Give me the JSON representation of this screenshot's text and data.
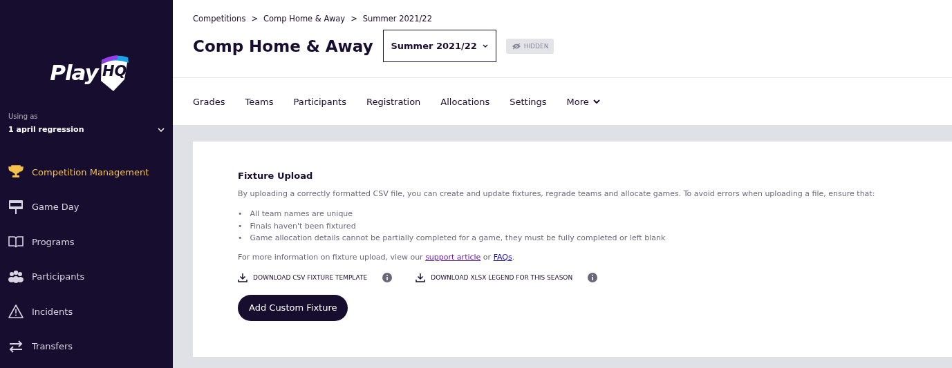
{
  "sidebar": {
    "logo": {
      "word": "Play",
      "badge": "HQ"
    },
    "using_as": {
      "label": "Using as",
      "value": "1 april regression"
    },
    "items": [
      {
        "label": "Competition Management",
        "selected": true
      },
      {
        "label": "Game Day",
        "selected": false
      },
      {
        "label": "Programs",
        "selected": false
      },
      {
        "label": "Participants",
        "selected": false
      },
      {
        "label": "Incidents",
        "selected": false
      },
      {
        "label": "Transfers",
        "selected": false
      }
    ]
  },
  "breadcrumbs": [
    "Competitions",
    "Comp Home & Away",
    "Summer 2021/22"
  ],
  "breadcrumb_separator": ">",
  "title": "Comp Home & Away",
  "season_dropdown": {
    "value": "Summer 2021/22"
  },
  "visibility_badge": {
    "label": "HIDDEN"
  },
  "tabs": [
    {
      "label": "Grades",
      "kind": "tab"
    },
    {
      "label": "Teams",
      "kind": "tab"
    },
    {
      "label": "Participants",
      "kind": "tab"
    },
    {
      "label": "Registration",
      "kind": "tab"
    },
    {
      "label": "Allocations",
      "kind": "tab"
    },
    {
      "label": "Settings",
      "kind": "tab"
    },
    {
      "label": "More",
      "kind": "menu"
    }
  ],
  "card": {
    "title": "Fixture Upload",
    "intro": "By uploading a correctly formatted CSV file, you can create and update fixtures, regrade teams and allocate games. To avoid errors when uploading a file, ensure that:",
    "rule_marker": "•",
    "rules": [
      "All team names are unique",
      "Finals haven't been fixtured",
      "Game allocation details cannot be partially completed for a game, they must be fully completed or left blank"
    ],
    "info": [
      {
        "kind": "text",
        "text": "For more information on fixture upload, view our "
      },
      {
        "kind": "link",
        "text": "support article",
        "visited": true
      },
      {
        "kind": "text",
        "text": " or "
      },
      {
        "kind": "link",
        "text": "FAQs",
        "visited": false
      },
      {
        "kind": "text",
        "text": "."
      }
    ],
    "downloads": [
      "DOWNLOAD CSV FIXTURE TEMPLATE",
      "DOWNLOAD XLSX LEGEND FOR THIS SEASON"
    ],
    "button": "Add Custom Fixture"
  }
}
